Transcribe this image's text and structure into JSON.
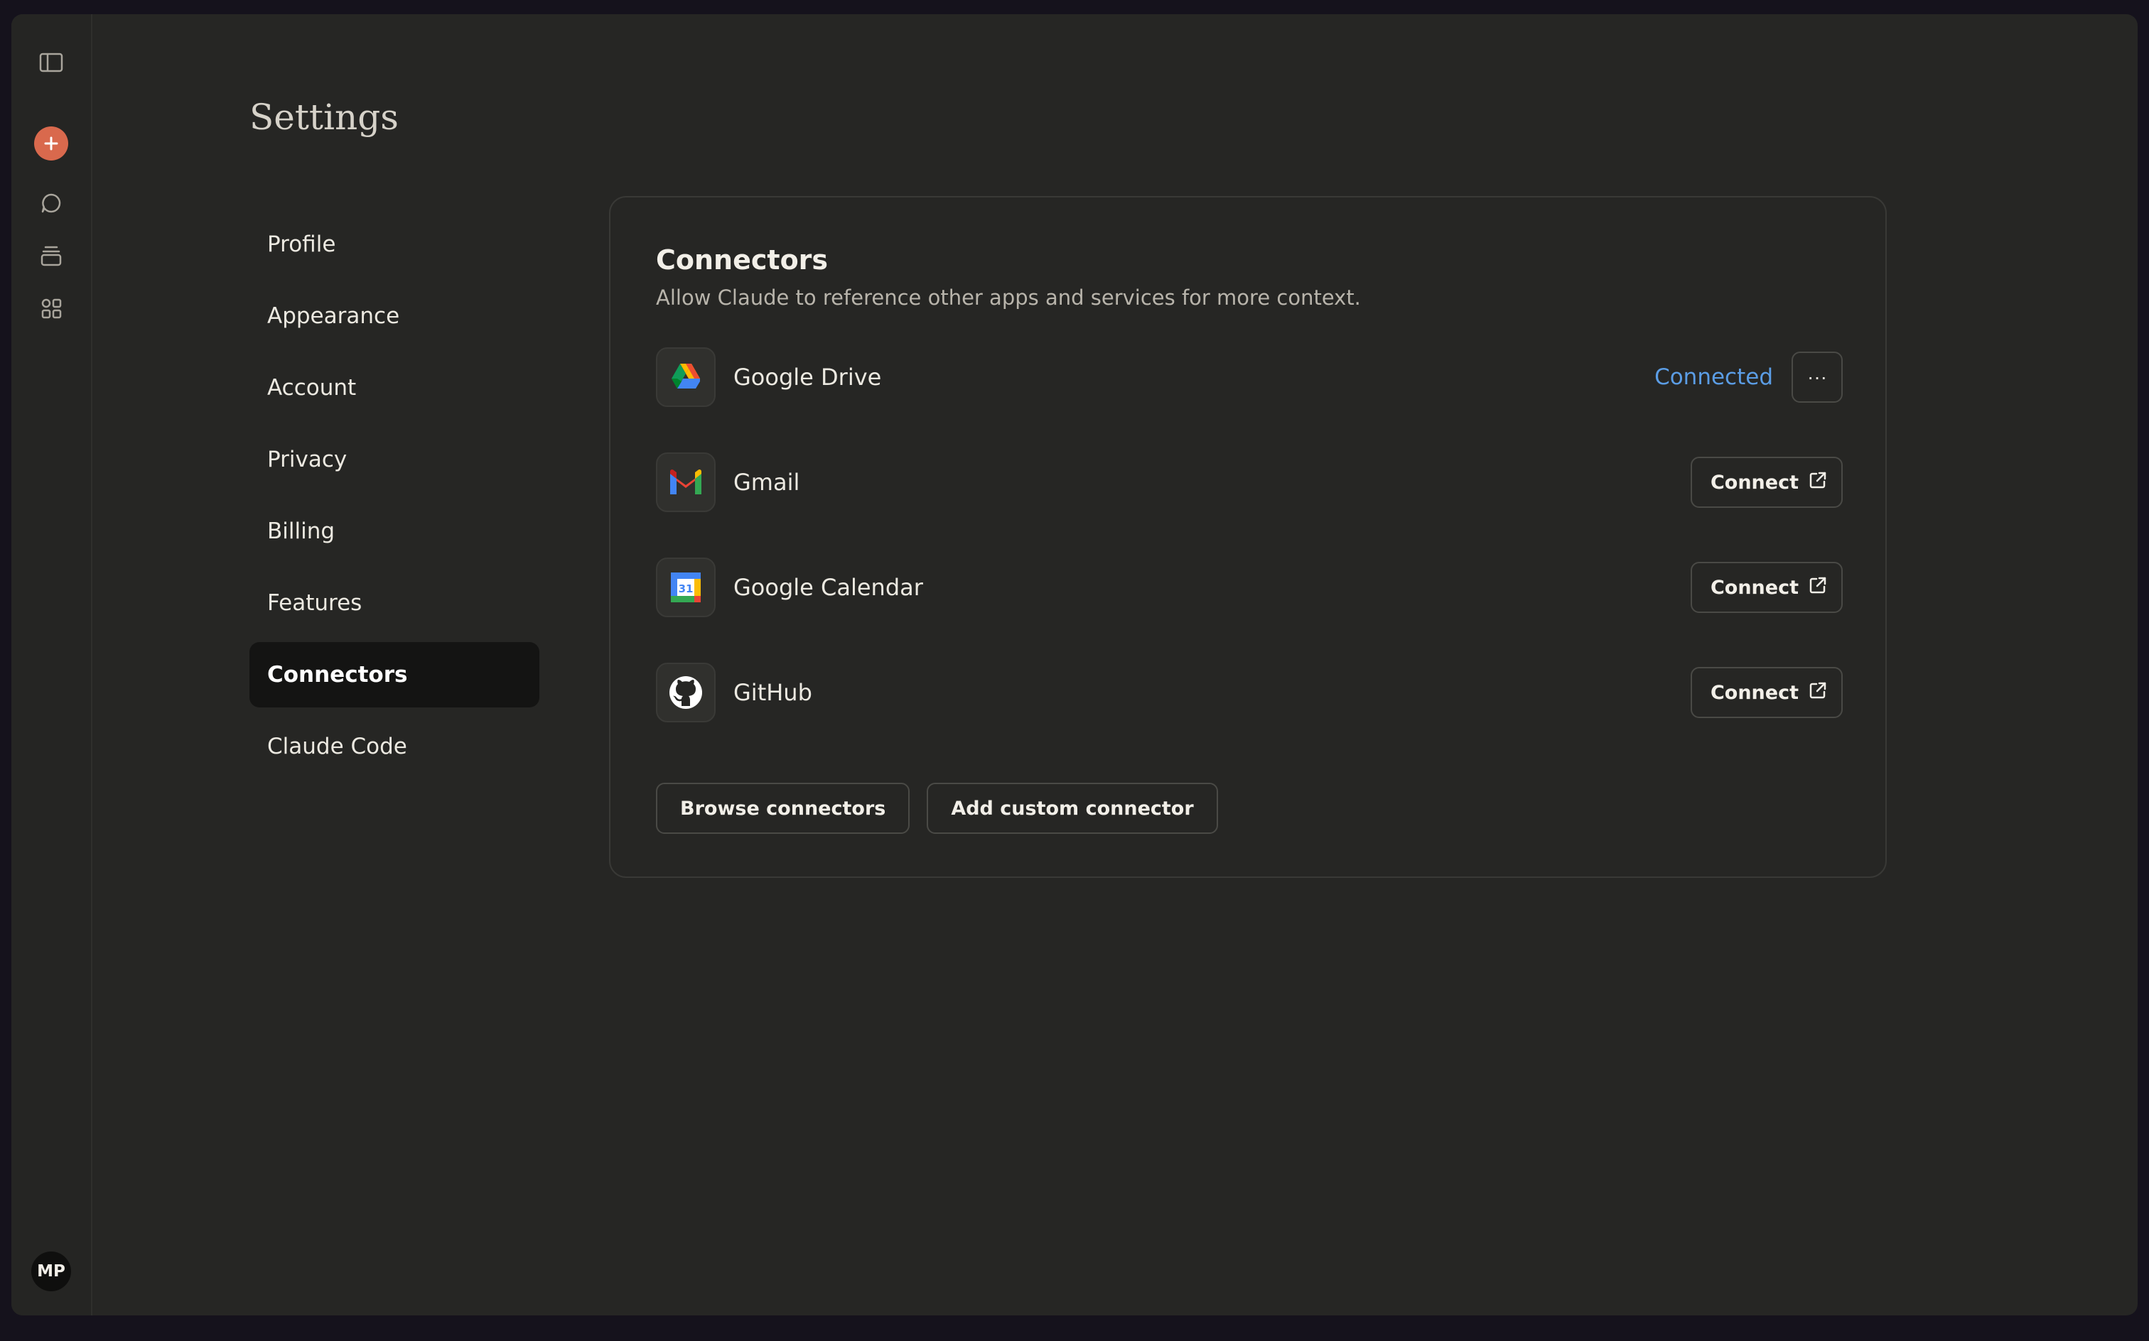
{
  "sidebar": {
    "icons": [
      "sidebar-toggle-icon",
      "plus-icon",
      "chat-icon",
      "projects-icon",
      "artifacts-icon"
    ],
    "avatar_initials": "MP",
    "accent": "#d9694d"
  },
  "page": {
    "title": "Settings"
  },
  "settings_nav": {
    "items": [
      {
        "label": "Profile"
      },
      {
        "label": "Appearance"
      },
      {
        "label": "Account"
      },
      {
        "label": "Privacy"
      },
      {
        "label": "Billing"
      },
      {
        "label": "Features"
      },
      {
        "label": "Connectors",
        "active": true
      },
      {
        "label": "Claude Code"
      }
    ]
  },
  "connectors": {
    "title": "Connectors",
    "subtitle": "Allow Claude to reference other apps and services for more context.",
    "items": [
      {
        "name": "Google Drive",
        "icon": "google-drive-icon",
        "status": "Connected",
        "more_label": "···"
      },
      {
        "name": "Gmail",
        "icon": "gmail-icon",
        "action": "Connect"
      },
      {
        "name": "Google Calendar",
        "icon": "google-calendar-icon",
        "action": "Connect",
        "calendar_day": "31"
      },
      {
        "name": "GitHub",
        "icon": "github-icon",
        "action": "Connect"
      }
    ],
    "browse_label": "Browse connectors",
    "add_custom_label": "Add custom connector",
    "connected_color": "#5b9de5"
  }
}
